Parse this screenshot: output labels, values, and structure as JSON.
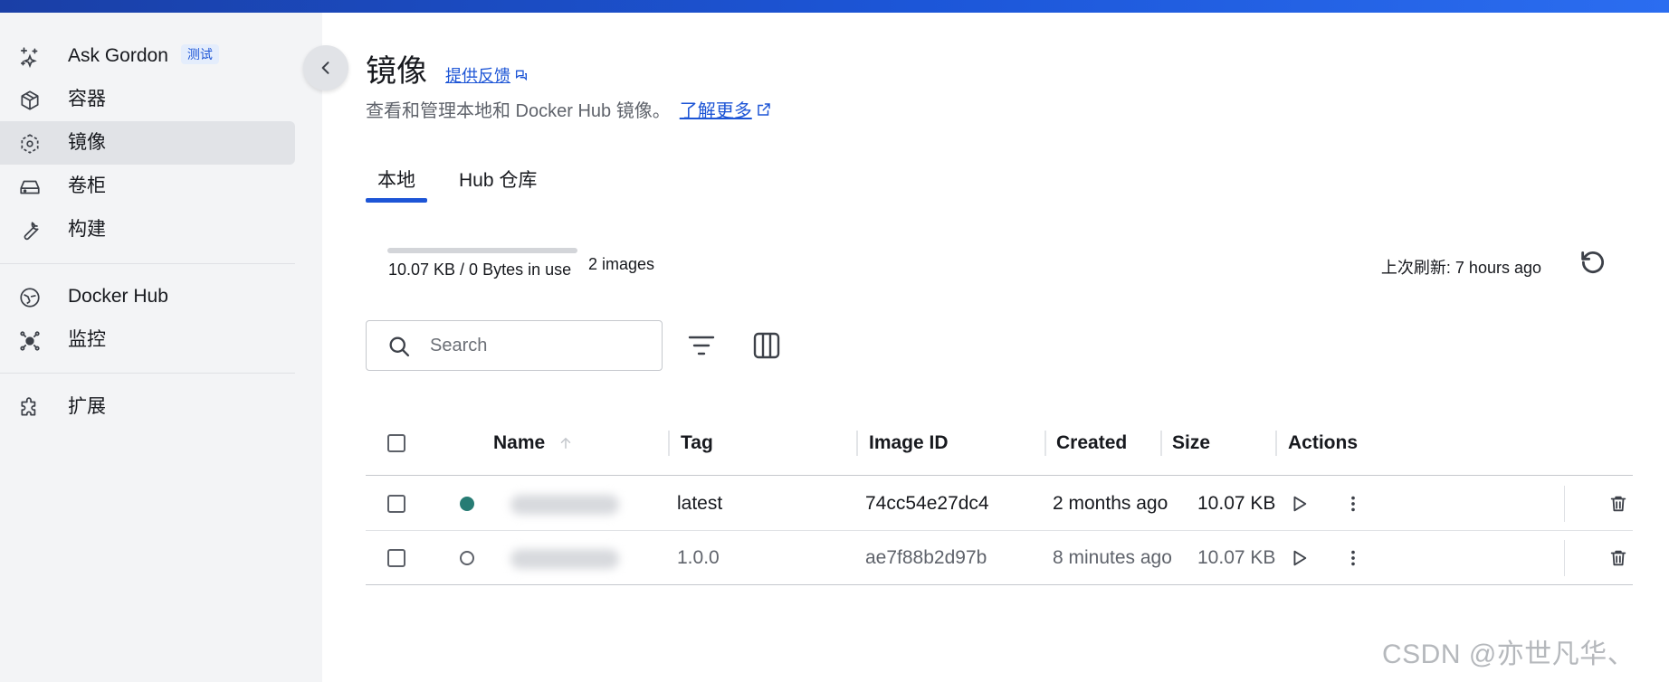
{
  "sidebar": {
    "items": [
      {
        "label": "Ask Gordon",
        "badge": "测试",
        "icon": "sparkles-icon"
      },
      {
        "label": "容器",
        "icon": "container-icon"
      },
      {
        "label": "镜像",
        "icon": "image-icon",
        "active": true
      },
      {
        "label": "卷柜",
        "icon": "volume-icon"
      },
      {
        "label": "构建",
        "icon": "wrench-icon"
      },
      {
        "label": "Docker Hub",
        "icon": "hub-icon"
      },
      {
        "label": "监控",
        "icon": "monitor-icon"
      },
      {
        "label": "扩展",
        "icon": "puzzle-icon"
      }
    ]
  },
  "header": {
    "title": "镜像",
    "feedback": "提供反馈",
    "subtitle": "查看和管理本地和 Docker Hub 镜像。",
    "learn_more": "了解更多"
  },
  "tabs": [
    {
      "label": "本地",
      "active": true
    },
    {
      "label": "Hub 仓库",
      "active": false
    }
  ],
  "usage": {
    "text": "10.07 KB / 0 Bytes in use",
    "fraction": 0.0,
    "count": "2 images"
  },
  "refresh": {
    "text": "上次刷新: 7 hours ago"
  },
  "search": {
    "placeholder": "Search"
  },
  "table": {
    "headers": {
      "name": "Name",
      "tag": "Tag",
      "image_id": "Image ID",
      "created": "Created",
      "size": "Size",
      "actions": "Actions"
    },
    "rows": [
      {
        "status": "running",
        "tag": "latest",
        "image_id": "74cc54e27dc4",
        "created": "2 months ago",
        "size": "10.07 KB"
      },
      {
        "status": "idle",
        "tag": "1.0.0",
        "image_id": "ae7f88b2d97b",
        "created": "8 minutes ago",
        "size": "10.07 KB"
      }
    ]
  },
  "colors": {
    "accent": "#1d55d6",
    "running": "#277c74",
    "sidebar_bg": "#f3f4f6"
  },
  "watermark": "CSDN @亦世凡华、"
}
